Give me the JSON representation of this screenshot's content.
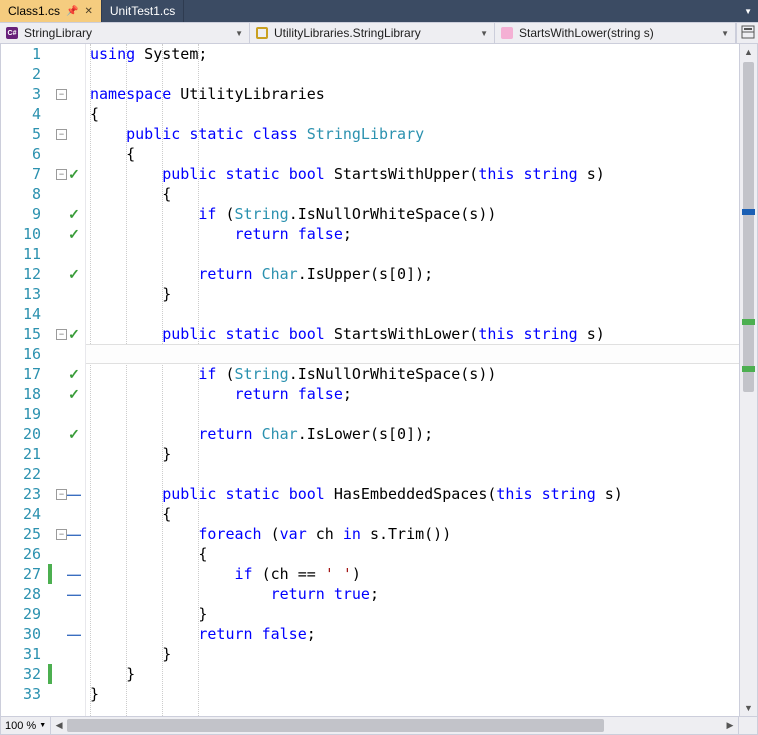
{
  "tabs": [
    {
      "label": "Class1.cs",
      "active": true
    },
    {
      "label": "UnitTest1.cs",
      "active": false
    }
  ],
  "nav": {
    "project": "StringLibrary",
    "class": "UtilityLibraries.StringLibrary",
    "member": "StartsWithLower(string s)"
  },
  "zoom": "100 %",
  "lines": [
    {
      "n": 1,
      "fold": "",
      "mark": "",
      "change": "",
      "tokens": [
        [
          "kw",
          "using"
        ],
        [
          "plain",
          " System;"
        ]
      ]
    },
    {
      "n": 2,
      "fold": "",
      "mark": "",
      "change": "",
      "tokens": []
    },
    {
      "n": 3,
      "fold": "-",
      "mark": "",
      "change": "",
      "tokens": [
        [
          "kw",
          "namespace"
        ],
        [
          "plain",
          " UtilityLibraries"
        ]
      ]
    },
    {
      "n": 4,
      "fold": "",
      "mark": "",
      "change": "",
      "tokens": [
        [
          "plain",
          "{"
        ]
      ]
    },
    {
      "n": 5,
      "fold": "-",
      "mark": "",
      "change": "",
      "tokens": [
        [
          "plain",
          "    "
        ],
        [
          "kw",
          "public"
        ],
        [
          "plain",
          " "
        ],
        [
          "kw",
          "static"
        ],
        [
          "plain",
          " "
        ],
        [
          "kw",
          "class"
        ],
        [
          "plain",
          " "
        ],
        [
          "type",
          "StringLibrary"
        ]
      ]
    },
    {
      "n": 6,
      "fold": "",
      "mark": "",
      "change": "",
      "tokens": [
        [
          "plain",
          "    {"
        ]
      ]
    },
    {
      "n": 7,
      "fold": "-",
      "mark": "check",
      "change": "",
      "tokens": [
        [
          "plain",
          "        "
        ],
        [
          "kw",
          "public"
        ],
        [
          "plain",
          " "
        ],
        [
          "kw",
          "static"
        ],
        [
          "plain",
          " "
        ],
        [
          "kw",
          "bool"
        ],
        [
          "plain",
          " StartsWithUpper("
        ],
        [
          "kw",
          "this"
        ],
        [
          "plain",
          " "
        ],
        [
          "kw",
          "string"
        ],
        [
          "plain",
          " s)"
        ]
      ]
    },
    {
      "n": 8,
      "fold": "",
      "mark": "",
      "change": "",
      "tokens": [
        [
          "plain",
          "        {"
        ]
      ]
    },
    {
      "n": 9,
      "fold": "",
      "mark": "check",
      "change": "",
      "tokens": [
        [
          "plain",
          "            "
        ],
        [
          "kw",
          "if"
        ],
        [
          "plain",
          " ("
        ],
        [
          "type",
          "String"
        ],
        [
          "plain",
          ".IsNullOrWhiteSpace(s))"
        ]
      ]
    },
    {
      "n": 10,
      "fold": "",
      "mark": "check",
      "change": "",
      "tokens": [
        [
          "plain",
          "                "
        ],
        [
          "kw",
          "return"
        ],
        [
          "plain",
          " "
        ],
        [
          "kw",
          "false"
        ],
        [
          "plain",
          ";"
        ]
      ]
    },
    {
      "n": 11,
      "fold": "",
      "mark": "",
      "change": "",
      "tokens": []
    },
    {
      "n": 12,
      "fold": "",
      "mark": "check",
      "change": "",
      "tokens": [
        [
          "plain",
          "            "
        ],
        [
          "kw",
          "return"
        ],
        [
          "plain",
          " "
        ],
        [
          "type",
          "Char"
        ],
        [
          "plain",
          ".IsUpper(s[0]);"
        ]
      ]
    },
    {
      "n": 13,
      "fold": "",
      "mark": "",
      "change": "",
      "tokens": [
        [
          "plain",
          "        }"
        ]
      ]
    },
    {
      "n": 14,
      "fold": "",
      "mark": "",
      "change": "",
      "tokens": []
    },
    {
      "n": 15,
      "fold": "-",
      "mark": "check",
      "change": "",
      "tokens": [
        [
          "plain",
          "        "
        ],
        [
          "kw",
          "public"
        ],
        [
          "plain",
          " "
        ],
        [
          "kw",
          "static"
        ],
        [
          "plain",
          " "
        ],
        [
          "kw",
          "bool"
        ],
        [
          "plain",
          " StartsWithLower("
        ],
        [
          "kw",
          "this"
        ],
        [
          "plain",
          " "
        ],
        [
          "kw",
          "string"
        ],
        [
          "plain",
          " s)"
        ]
      ]
    },
    {
      "n": 16,
      "fold": "",
      "mark": "",
      "change": "",
      "tokens": [
        [
          "plain",
          "        {"
        ]
      ],
      "current": true
    },
    {
      "n": 17,
      "fold": "",
      "mark": "check",
      "change": "",
      "tokens": [
        [
          "plain",
          "            "
        ],
        [
          "kw",
          "if"
        ],
        [
          "plain",
          " ("
        ],
        [
          "type",
          "String"
        ],
        [
          "plain",
          ".IsNullOrWhiteSpace(s))"
        ]
      ]
    },
    {
      "n": 18,
      "fold": "",
      "mark": "check",
      "change": "",
      "tokens": [
        [
          "plain",
          "                "
        ],
        [
          "kw",
          "return"
        ],
        [
          "plain",
          " "
        ],
        [
          "kw",
          "false"
        ],
        [
          "plain",
          ";"
        ]
      ]
    },
    {
      "n": 19,
      "fold": "",
      "mark": "",
      "change": "",
      "tokens": []
    },
    {
      "n": 20,
      "fold": "",
      "mark": "check",
      "change": "",
      "tokens": [
        [
          "plain",
          "            "
        ],
        [
          "kw",
          "return"
        ],
        [
          "plain",
          " "
        ],
        [
          "type",
          "Char"
        ],
        [
          "plain",
          ".IsLower(s[0]);"
        ]
      ]
    },
    {
      "n": 21,
      "fold": "",
      "mark": "",
      "change": "",
      "tokens": [
        [
          "plain",
          "        }"
        ]
      ]
    },
    {
      "n": 22,
      "fold": "",
      "mark": "",
      "change": "",
      "tokens": []
    },
    {
      "n": 23,
      "fold": "-",
      "mark": "dash",
      "change": "",
      "tokens": [
        [
          "plain",
          "        "
        ],
        [
          "kw",
          "public"
        ],
        [
          "plain",
          " "
        ],
        [
          "kw",
          "static"
        ],
        [
          "plain",
          " "
        ],
        [
          "kw",
          "bool"
        ],
        [
          "plain",
          " HasEmbeddedSpaces("
        ],
        [
          "kw",
          "this"
        ],
        [
          "plain",
          " "
        ],
        [
          "kw",
          "string"
        ],
        [
          "plain",
          " s)"
        ]
      ]
    },
    {
      "n": 24,
      "fold": "",
      "mark": "",
      "change": "",
      "tokens": [
        [
          "plain",
          "        {"
        ]
      ]
    },
    {
      "n": 25,
      "fold": "-",
      "mark": "dash",
      "change": "",
      "tokens": [
        [
          "plain",
          "            "
        ],
        [
          "kw",
          "foreach"
        ],
        [
          "plain",
          " ("
        ],
        [
          "kw",
          "var"
        ],
        [
          "plain",
          " ch "
        ],
        [
          "kw",
          "in"
        ],
        [
          "plain",
          " s.Trim())"
        ]
      ]
    },
    {
      "n": 26,
      "fold": "",
      "mark": "",
      "change": "",
      "tokens": [
        [
          "plain",
          "            {"
        ]
      ]
    },
    {
      "n": 27,
      "fold": "",
      "mark": "dash",
      "change": "green",
      "tokens": [
        [
          "plain",
          "                "
        ],
        [
          "kw",
          "if"
        ],
        [
          "plain",
          " (ch == "
        ],
        [
          "str",
          "' '"
        ],
        [
          "plain",
          ")"
        ]
      ]
    },
    {
      "n": 28,
      "fold": "",
      "mark": "dash",
      "change": "",
      "tokens": [
        [
          "plain",
          "                    "
        ],
        [
          "kw",
          "return"
        ],
        [
          "plain",
          " "
        ],
        [
          "kw",
          "true"
        ],
        [
          "plain",
          ";"
        ]
      ]
    },
    {
      "n": 29,
      "fold": "",
      "mark": "",
      "change": "",
      "tokens": [
        [
          "plain",
          "            }"
        ]
      ]
    },
    {
      "n": 30,
      "fold": "",
      "mark": "dash",
      "change": "",
      "tokens": [
        [
          "plain",
          "            "
        ],
        [
          "kw",
          "return"
        ],
        [
          "plain",
          " "
        ],
        [
          "kw",
          "false"
        ],
        [
          "plain",
          ";"
        ]
      ]
    },
    {
      "n": 31,
      "fold": "",
      "mark": "",
      "change": "",
      "tokens": [
        [
          "plain",
          "        }"
        ]
      ]
    },
    {
      "n": 32,
      "fold": "",
      "mark": "",
      "change": "green",
      "tokens": [
        [
          "plain",
          "    }"
        ]
      ]
    },
    {
      "n": 33,
      "fold": "",
      "mark": "",
      "change": "",
      "tokens": [
        [
          "plain",
          "}"
        ]
      ]
    }
  ]
}
